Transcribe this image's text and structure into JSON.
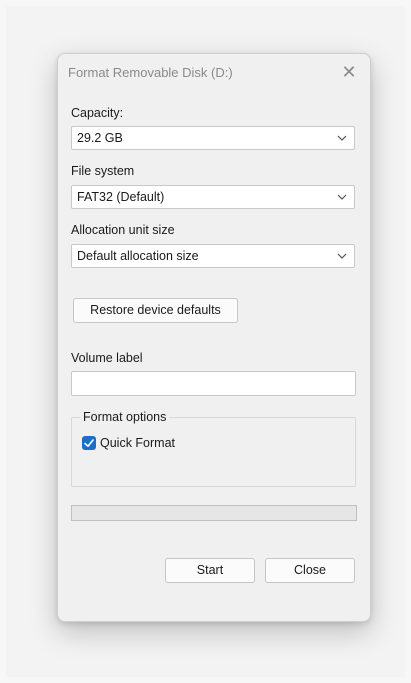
{
  "window": {
    "title": "Format Removable Disk (D:)",
    "close_glyph": "✕"
  },
  "fields": {
    "capacity": {
      "label": "Capacity:",
      "value": "29.2 GB"
    },
    "file_system": {
      "label": "File system",
      "value": "FAT32 (Default)"
    },
    "allocation_unit_size": {
      "label": "Allocation unit size",
      "value": "Default allocation size"
    }
  },
  "restore_defaults_label": "Restore device defaults",
  "volume_label": {
    "label": "Volume label",
    "value": ""
  },
  "format_options": {
    "legend": "Format options",
    "quick_format": {
      "label": "Quick Format",
      "checked": true
    }
  },
  "progress": {
    "value": 0
  },
  "buttons": {
    "start": "Start",
    "close": "Close"
  },
  "colors": {
    "accent": "#1b6fc9",
    "dialog_bg": "#f0f0f0",
    "progress_fill": "#06b025"
  },
  "icons": {
    "dropdown": "chevron-down-icon",
    "checkbox": "checkmark-icon",
    "close": "close-icon"
  }
}
